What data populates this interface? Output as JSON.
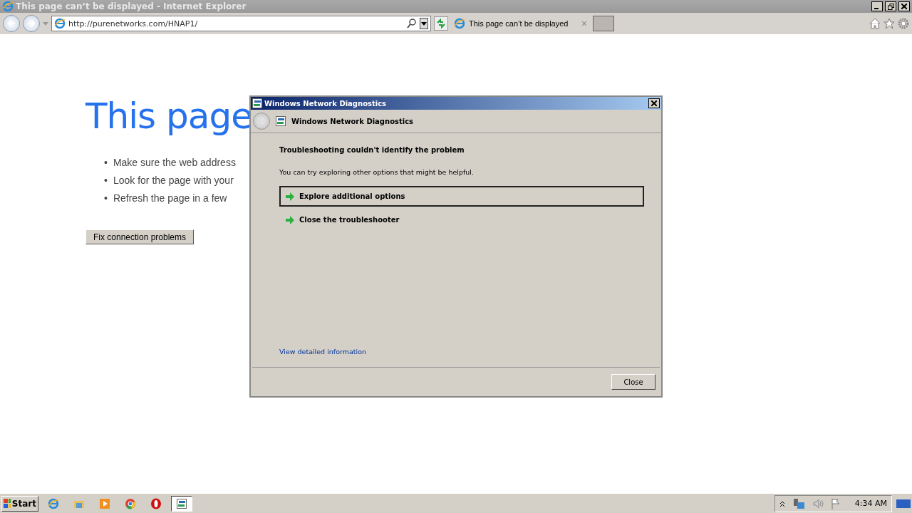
{
  "window": {
    "title": "This page can’t be displayed - Internet Explorer"
  },
  "address_bar": {
    "value": "http://purenetworks.com/HNAP1/"
  },
  "tabs": [
    {
      "label": "This page can’t be displayed",
      "selected": true,
      "close": "×"
    }
  ],
  "page": {
    "heading": "This page",
    "bullets": [
      {
        "marker": "•",
        "text": "Make sure the web address"
      },
      {
        "marker": "•",
        "text": "Look for the page with your"
      },
      {
        "marker": "•",
        "text": "Refresh the page in a few"
      }
    ],
    "button": "Fix connection problems"
  },
  "dialog": {
    "title": "Windows Network Diagnostics",
    "header": "Windows Network Diagnostics",
    "heading": "Troubleshooting couldn't identify the problem",
    "message": "You can try exploring other options that might be helpful.",
    "options": [
      {
        "label": "Explore additional options",
        "selected": true
      },
      {
        "label": "Close the troubleshooter",
        "selected": false
      }
    ],
    "link": "View detailed information",
    "button": "Close"
  },
  "taskbar": {
    "start": "Start",
    "apps": [
      {
        "kind": "ie",
        "selected": false
      },
      {
        "kind": "folder",
        "selected": false
      },
      {
        "kind": "media",
        "selected": false
      },
      {
        "kind": "chrome",
        "selected": false
      },
      {
        "kind": "opera",
        "selected": false
      },
      {
        "kind": "diag",
        "selected": true
      }
    ],
    "clock": "4:34 AM"
  }
}
